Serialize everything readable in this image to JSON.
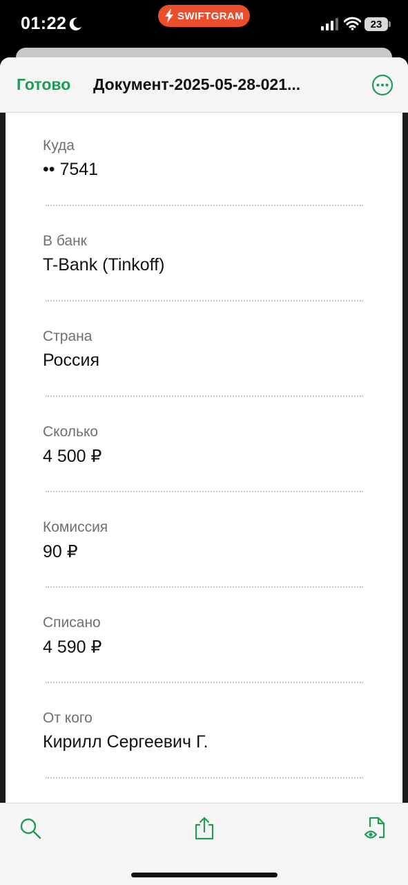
{
  "status_bar": {
    "time": "01:22",
    "app_badge": "SWIFTGRAM",
    "battery": "23"
  },
  "nav": {
    "done_label": "Готово",
    "title": "Документ-2025-05-28-021..."
  },
  "fields": [
    {
      "label": "Куда",
      "value": "•• 7541"
    },
    {
      "label": "В банк",
      "value": "T-Bank (Tinkoff)"
    },
    {
      "label": "Страна",
      "value": "Россия"
    },
    {
      "label": "Сколько",
      "value": "4 500 ₽"
    },
    {
      "label": "Комиссия",
      "value": "90 ₽"
    },
    {
      "label": "Списано",
      "value": "4 590 ₽"
    },
    {
      "label": "От кого",
      "value": "Кирилл Сергеевич Г."
    }
  ],
  "toolbar": {
    "icons": [
      "search-icon",
      "share-icon",
      "document-preview-icon"
    ]
  },
  "colors": {
    "accent": "#1e9b55",
    "app_badge": "#ea4e2c",
    "label_gray": "#6f6f6f"
  }
}
